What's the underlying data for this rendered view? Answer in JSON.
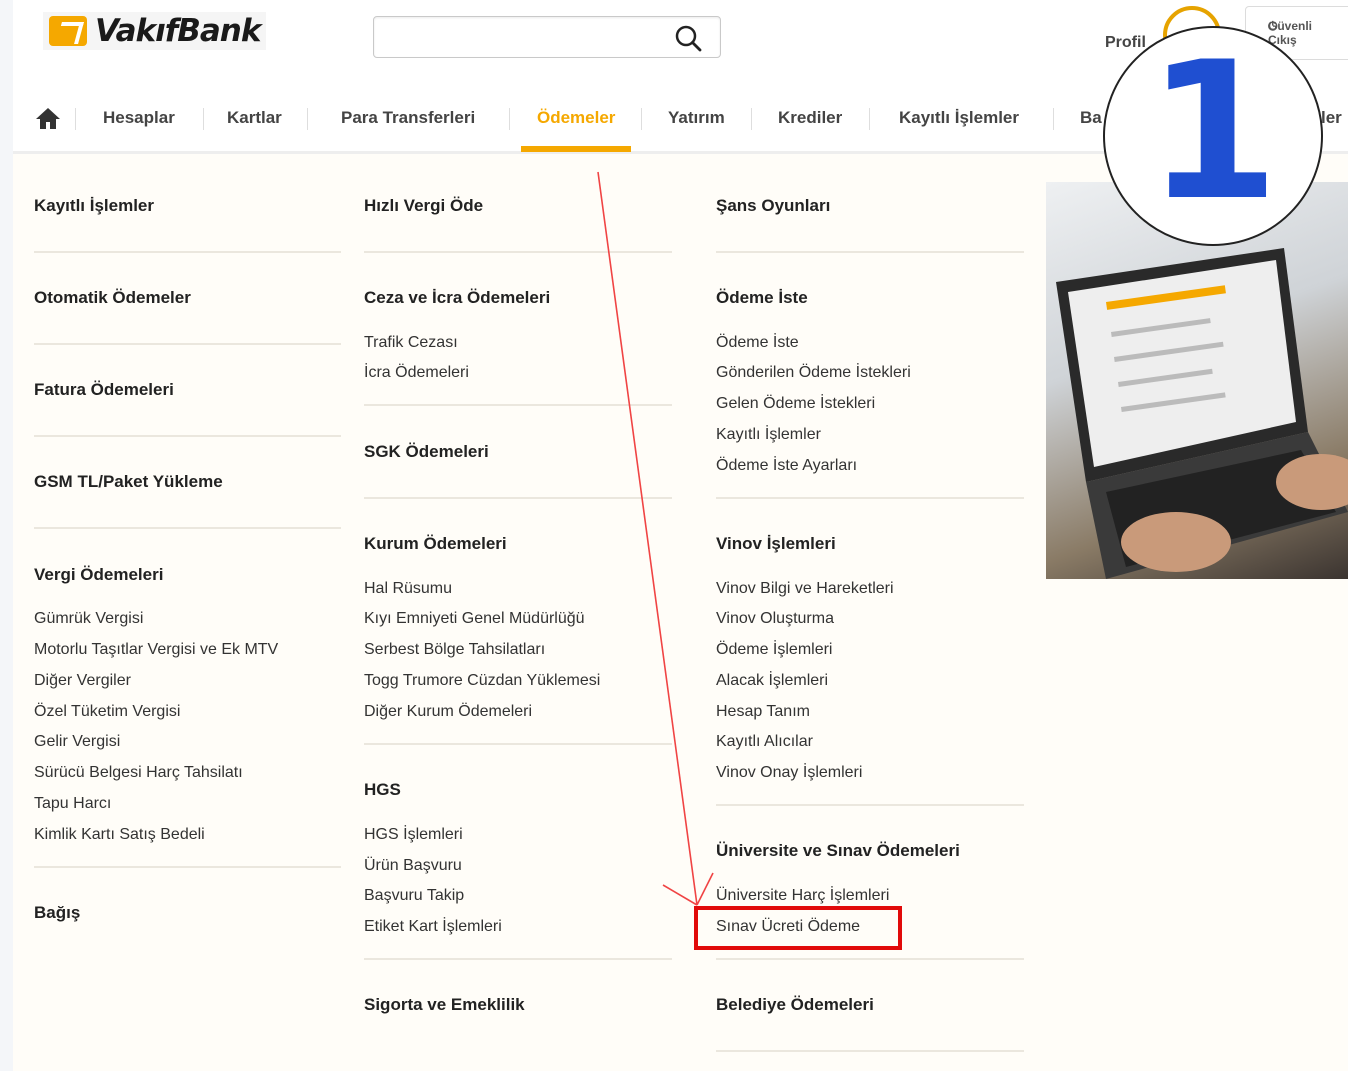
{
  "header": {
    "logo_text": "VakıfBank",
    "search": {
      "value": "",
      "placeholder": ""
    },
    "profile_label": "Profil",
    "secure_logout_label": "Güvenli Çıkış"
  },
  "nav": {
    "items": [
      {
        "label": "Hesaplar"
      },
      {
        "label": "Kartlar"
      },
      {
        "label": "Para Transferleri"
      },
      {
        "label": "Ödemeler",
        "active": true
      },
      {
        "label": "Yatırım"
      },
      {
        "label": "Krediler"
      },
      {
        "label": "Kayıtlı İşlemler"
      },
      {
        "label": "Ba"
      },
      {
        "label": "ler"
      }
    ]
  },
  "menu": {
    "col1": {
      "kayitli": "Kayıtlı İşlemler",
      "otomatik": "Otomatik Ödemeler",
      "fatura": "Fatura Ödemeleri",
      "gsm": "GSM TL/Paket Yükleme",
      "vergi": {
        "title": "Vergi Ödemeleri",
        "links": [
          "Gümrük Vergisi",
          "Motorlu Taşıtlar Vergisi ve Ek MTV",
          "Diğer Vergiler",
          "Özel Tüketim Vergisi",
          "Gelir Vergisi",
          "Sürücü Belgesi Harç Tahsilatı",
          "Tapu Harcı",
          "Kimlik Kartı Satış Bedeli"
        ]
      },
      "bagis": "Bağış"
    },
    "col2": {
      "hizli_vergi": "Hızlı Vergi Öde",
      "ceza": {
        "title": "Ceza ve İcra Ödemeleri",
        "links": [
          "Trafik Cezası",
          "İcra Ödemeleri"
        ]
      },
      "sgk": "SGK Ödemeleri",
      "kurum": {
        "title": "Kurum Ödemeleri",
        "links": [
          "Hal Rüsumu",
          "Kıyı Emniyeti Genel Müdürlüğü",
          "Serbest Bölge Tahsilatları",
          "Togg Trumore Cüzdan Yüklemesi",
          "Diğer Kurum Ödemeleri"
        ]
      },
      "hgs": {
        "title": "HGS",
        "links": [
          "HGS İşlemleri",
          "Ürün Başvuru",
          "Başvuru Takip",
          "Etiket Kart İşlemleri"
        ]
      },
      "sigorta": "Sigorta ve Emeklilik"
    },
    "col3": {
      "sans": "Şans Oyunları",
      "odeme_iste": {
        "title": "Ödeme İste",
        "links": [
          "Ödeme İste",
          "Gönderilen Ödeme İstekleri",
          "Gelen Ödeme İstekleri",
          "Kayıtlı İşlemler",
          "Ödeme İste Ayarları"
        ]
      },
      "vinov": {
        "title": "Vinov İşlemleri",
        "links": [
          "Vinov Bilgi ve Hareketleri",
          "Vinov Oluşturma",
          "Ödeme İşlemleri",
          "Alacak İşlemleri",
          "Hesap Tanım",
          "Kayıtlı Alıcılar",
          "Vinov Onay İşlemleri"
        ]
      },
      "universite": {
        "title": "Üniversite ve Sınav Ödemeleri",
        "links": [
          "Üniversite Harç İşlemleri",
          "Sınav Ücreti Ödeme"
        ]
      },
      "belediye": "Belediye Ödemeleri"
    }
  },
  "annotation": {
    "step_number": "1",
    "highlight_color": "#e10a0a",
    "number_color": "#1f4fd1"
  },
  "colors": {
    "accent": "#f5a800"
  }
}
